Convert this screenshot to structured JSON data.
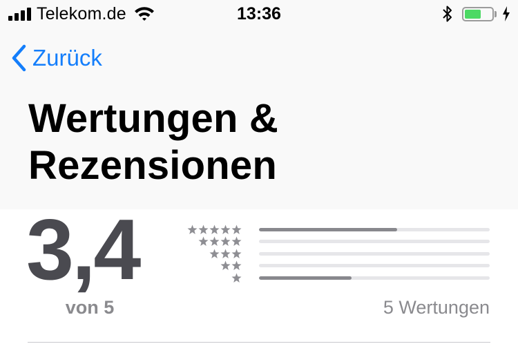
{
  "status_bar": {
    "carrier": "Telekom.de",
    "time": "13:36",
    "battery_level": 0.6,
    "icons": [
      "signal-icon",
      "wifi-icon",
      "bluetooth-icon",
      "battery-icon",
      "charging-icon"
    ],
    "battery_color": "#4cd964"
  },
  "nav": {
    "back_label": "Zurück",
    "back_icon": "chevron-left-icon",
    "accent": "#147efb"
  },
  "title": "Wertungen & Rezensionen",
  "ratings": {
    "average": "3,4",
    "out_of": "von 5",
    "count_label": "5 Wertungen",
    "distribution": [
      {
        "stars": 5,
        "fraction": 0.6
      },
      {
        "stars": 4,
        "fraction": 0.0
      },
      {
        "stars": 3,
        "fraction": 0.0
      },
      {
        "stars": 2,
        "fraction": 0.0
      },
      {
        "stars": 1,
        "fraction": 0.4
      }
    ]
  }
}
